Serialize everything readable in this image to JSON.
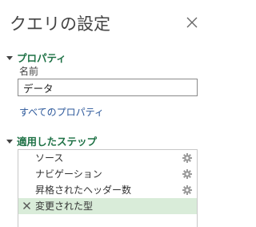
{
  "pane": {
    "title": "クエリの設定",
    "close_icon": "close-icon"
  },
  "properties": {
    "header": "プロパティ",
    "name_label": "名前",
    "name_value": "データ",
    "all_properties_link": "すべてのプロパティ"
  },
  "applied_steps": {
    "header": "適用したステップ",
    "steps": [
      {
        "label": "ソース",
        "icon": "gear-icon",
        "selected": false
      },
      {
        "label": "ナビゲーション",
        "icon": "gear-icon",
        "selected": false
      },
      {
        "label": "昇格されたヘッダー数",
        "icon": "gear-icon",
        "selected": false
      },
      {
        "label": "変更された型",
        "icon": "delete-icon",
        "selected": true
      }
    ]
  },
  "colors": {
    "accent_green": "#1e7145",
    "link_blue": "#2b579a",
    "selected_row": "#d9ecd9"
  }
}
